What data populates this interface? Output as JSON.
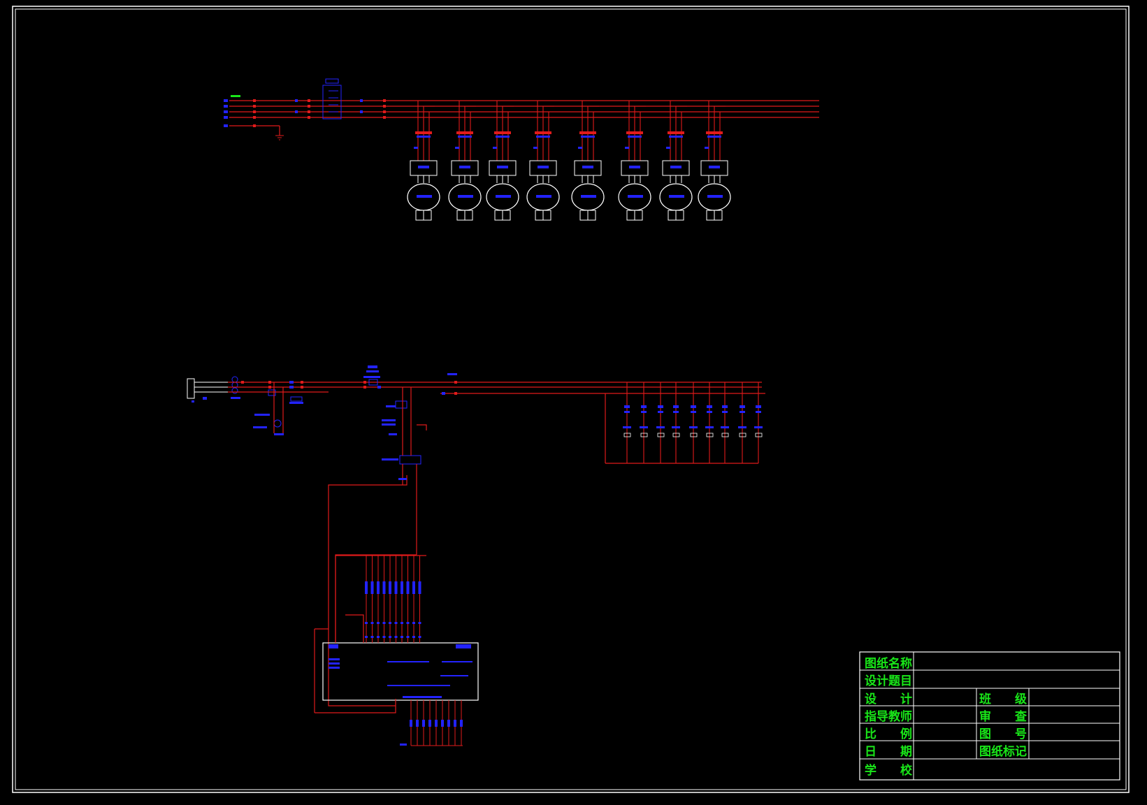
{
  "title_block": {
    "drawing_name_label": "图纸名称",
    "design_topic_label": "设计题目",
    "design_label": "设　　计",
    "class_label": "班　　级",
    "instructor_label": "指导教师",
    "review_label": "审　　查",
    "scale_label": "比　　例",
    "drawing_no_label": "图　　号",
    "date_label": "日　　期",
    "drawing_mark_label": "图纸标记",
    "school_label": "学　　校"
  },
  "colors": {
    "background": "#000000",
    "border": "#ffffff",
    "wire": "#e01b1b",
    "component": "#2323ff",
    "label": "#19e619"
  },
  "power_diagram": {
    "motor_count": 8
  }
}
